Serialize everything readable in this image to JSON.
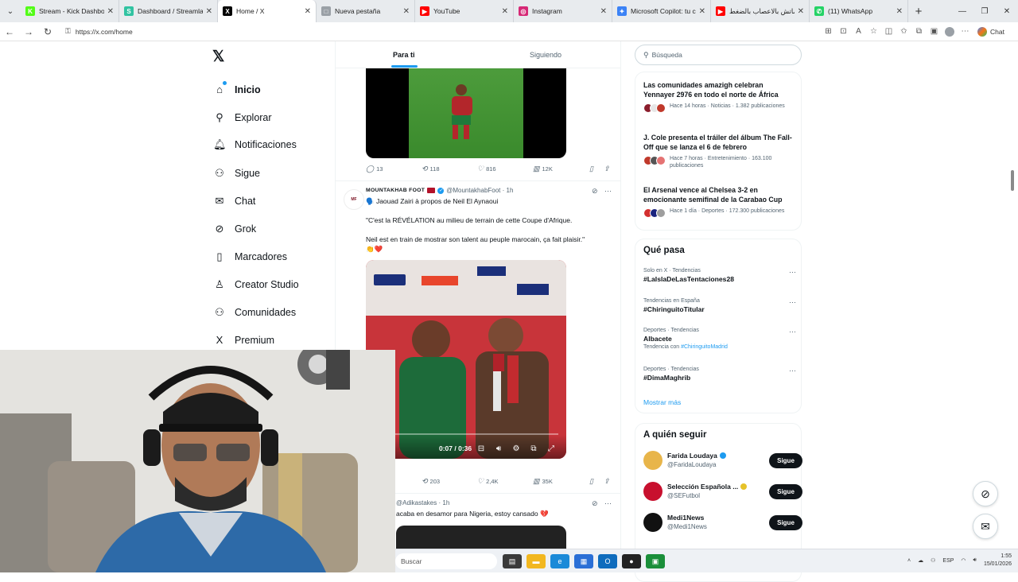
{
  "browser": {
    "tabs": [
      {
        "label": "Stream - Kick Dashboard",
        "color": "#53fc18",
        "glyph": "K",
        "active": false
      },
      {
        "label": "Dashboard / Streamlabs",
        "color": "#31c3a2",
        "glyph": "S",
        "active": false
      },
      {
        "label": "Home / X",
        "color": "#000000",
        "glyph": "X",
        "active": true
      },
      {
        "label": "Nueva pestaña",
        "color": "#9aa0a6",
        "glyph": "□",
        "active": false
      },
      {
        "label": "YouTube",
        "color": "#ff0000",
        "glyph": "▶",
        "active": false
      },
      {
        "label": "Instagram",
        "color": "#d62976",
        "glyph": "◎",
        "active": false
      },
      {
        "label": "Microsoft Copilot: tu co",
        "color": "#3b82f6",
        "glyph": "✦",
        "active": false
      },
      {
        "label": "ماتش بالاعصاب بالضغط",
        "color": "#ff0000",
        "glyph": "▶",
        "active": false
      },
      {
        "label": "(11) WhatsApp",
        "color": "#25d366",
        "glyph": "✆",
        "active": false
      }
    ],
    "url": "https://x.com/home",
    "chat_label": "Chat"
  },
  "nav": {
    "items": [
      {
        "label": "Inicio",
        "icon": "home-icon",
        "glyph": "⌂"
      },
      {
        "label": "Explorar",
        "icon": "search-icon",
        "glyph": "⚲"
      },
      {
        "label": "Notificaciones",
        "icon": "bell-icon",
        "glyph": "🔔︎"
      },
      {
        "label": "Sigue",
        "icon": "follow-icon",
        "glyph": "⚇"
      },
      {
        "label": "Chat",
        "icon": "mail-icon",
        "glyph": "✉"
      },
      {
        "label": "Grok",
        "icon": "grok-icon",
        "glyph": "⊘"
      },
      {
        "label": "Marcadores",
        "icon": "bookmark-icon",
        "glyph": "▯"
      },
      {
        "label": "Creator Studio",
        "icon": "flask-icon",
        "glyph": "♙"
      },
      {
        "label": "Comunidades",
        "icon": "community-icon",
        "glyph": "⚇"
      },
      {
        "label": "Premium",
        "icon": "x-logo-icon",
        "glyph": "X"
      }
    ]
  },
  "feed": {
    "tabs": [
      "Para ti",
      "Siguiendo"
    ],
    "post1_actions": {
      "replies": "13",
      "reposts": "118",
      "likes": "816",
      "views": "12K"
    },
    "post2": {
      "author": "MOUNTAKHAB FOOT",
      "handle": "@MountakhabFoot",
      "time": "1h",
      "line1": "🗣️ Jaouad Zairi à propos de Neil El Aynaoui",
      "line2": "\"C'est la RÉVÉLATION au milieu de terrain de cette Coupe d'Afrique.",
      "line3": "Neil est en train de mostrar son talent au peuple marocain, ça fait plaisir.\"",
      "emoji": "👏❤️",
      "video_time": "0:07 / 0:36",
      "reposts": "203",
      "likes": "2,4K",
      "views": "35K"
    },
    "post3": {
      "handle": "@Adikastakes",
      "time": "1h",
      "text": "acaba en desamor para Nigeria, estoy cansado 💔"
    }
  },
  "right": {
    "search_placeholder": "Búsqueda",
    "news": [
      {
        "title": "Las comunidades amazigh celebran Yennayer 2976 en todo el norte de África",
        "meta": "Hace 14 horas · Noticias · 1.382 publicaciones"
      },
      {
        "title": "J. Cole presenta el tráiler del álbum The Fall-Off que se lanza el 6 de febrero",
        "meta": "Hace 7 horas · Entretenimiento · 163.100 publicaciones"
      },
      {
        "title": "El Arsenal vence al Chelsea 3-2 en emocionante semifinal de la Carabao Cup",
        "meta": "Hace 1 día · Deportes · 172.300 publicaciones"
      }
    ],
    "que_pasa": "Qué pasa",
    "trends": [
      {
        "meta": "Solo en X · Tendencias",
        "name": "#LaIslaDeLasTentaciones28",
        "sub": ""
      },
      {
        "meta": "Tendencias en España",
        "name": "#ChiringuitoTitular",
        "sub": ""
      },
      {
        "meta": "Deportes · Tendencias",
        "name": "Albacete",
        "sub_prefix": "Tendencia con ",
        "sub": "#ChiringuitoMadrid"
      },
      {
        "meta": "Deportes · Tendencias",
        "name": "#DimaMaghrib",
        "sub": ""
      }
    ],
    "show_more": "Mostrar más",
    "who_to_follow": "A quién seguir",
    "follows": [
      {
        "name": "Farida Loudaya",
        "handle": "@FaridaLoudaya",
        "badge": "#1d9bf0",
        "button": "Sigue"
      },
      {
        "name": "Selección Española ...",
        "handle": "@SEFutbol",
        "badge": "#e6c229",
        "button": "Sigue"
      },
      {
        "name": "Medi1News",
        "handle": "@Medi1News",
        "badge": "",
        "button": "Sigue"
      }
    ]
  },
  "taskbar": {
    "search_label": "Buscar",
    "lang": "ESP",
    "time": "1:55",
    "date": "15/01/2026"
  }
}
